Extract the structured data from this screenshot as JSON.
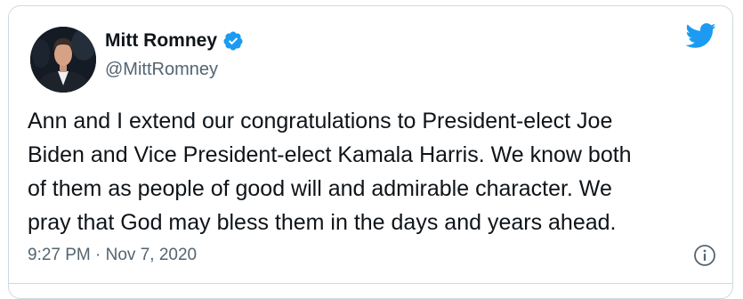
{
  "author": {
    "name": "Mitt Romney",
    "handle": "@MittRomney",
    "verified": true,
    "avatar_icon": "profile-photo"
  },
  "tweet": {
    "text": "Ann and I extend our congratulations to President-elect Joe\nBiden and Vice President-elect Kamala Harris. We know both\nof them as people of good will and admirable character. We\npray that God may bless them in the days and years ahead.",
    "timestamp": "9:27 PM · Nov 7, 2020"
  },
  "icons": {
    "brand": "twitter-bird-icon",
    "verified": "verified-badge-icon",
    "info": "info-icon"
  },
  "colors": {
    "brand_blue": "#1d9bf0",
    "text": "#0f1419",
    "secondary_text": "#536471",
    "border": "#cfd9de"
  }
}
